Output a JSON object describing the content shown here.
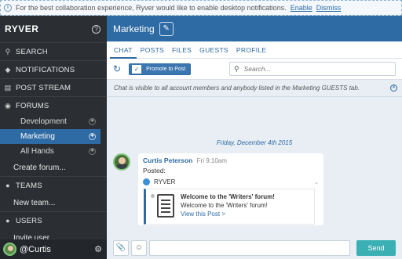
{
  "notice": {
    "text": "For the best collaboration experience, Ryver would like to enable desktop notifications.",
    "enable": "Enable",
    "dismiss": "Dismiss"
  },
  "sidebar": {
    "brand": "RYVER",
    "help": "?",
    "nav": {
      "search": "SEARCH",
      "notifications": "NOTIFICATIONS",
      "post_stream": "POST STREAM",
      "forums": "FORUMS",
      "teams": "TEAMS",
      "users": "USERS"
    },
    "forums": [
      "Development",
      "Marketing",
      "All Hands"
    ],
    "active_forum": "Marketing",
    "create_forum": "Create forum...",
    "new_team": "New team...",
    "invite_user": "Invite user...",
    "username": "@Curtis"
  },
  "header": {
    "title": "Marketing"
  },
  "tabs": [
    "CHAT",
    "POSTS",
    "FILES",
    "GUESTS",
    "PROFILE"
  ],
  "active_tab": "CHAT",
  "toolbar": {
    "promote_label": "Promote to Post",
    "search_placeholder": "Search..."
  },
  "banner": "Chat is visible to all account members and anybody listed in the Marketing GUESTS tab.",
  "date_divider": "Friday, December 4th 2015",
  "message": {
    "author": "Curtis Peterson",
    "time": "Fri 9:10am",
    "text": "Posted:",
    "source": "RYVER",
    "card_title": "Welcome to the 'Writers' forum!",
    "card_body": "Welcome to the 'Writers' forum!",
    "card_link": "View this Post >"
  },
  "composer": {
    "send": "Send"
  },
  "colors": {
    "accent": "#2e6aa3",
    "sidebar": "#2b2f33",
    "send": "#3ab0b4"
  }
}
